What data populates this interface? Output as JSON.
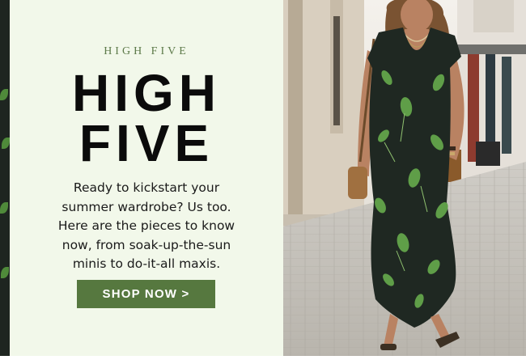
{
  "promo": {
    "eyebrow": "HIGH FIVE",
    "headline_line1": "HIGH",
    "headline_line2": "FIVE",
    "body_lines": [
      "Ready to kickstart your",
      "summer wardrobe? Us too.",
      "Here are the pieces to know",
      "now, from soak-up-the-sun",
      "minis to do-it-all maxis."
    ],
    "cta_label": "SHOP NOW >"
  },
  "photo": {
    "subject": "woman-in-floral-maxi-dress",
    "accent_colors": {
      "panel_bg": "#f2f8ea",
      "cta_bg": "#56783f",
      "eyebrow": "#5d7a4a",
      "dress": "#1f2822",
      "leaf": "#5f9e48"
    }
  }
}
